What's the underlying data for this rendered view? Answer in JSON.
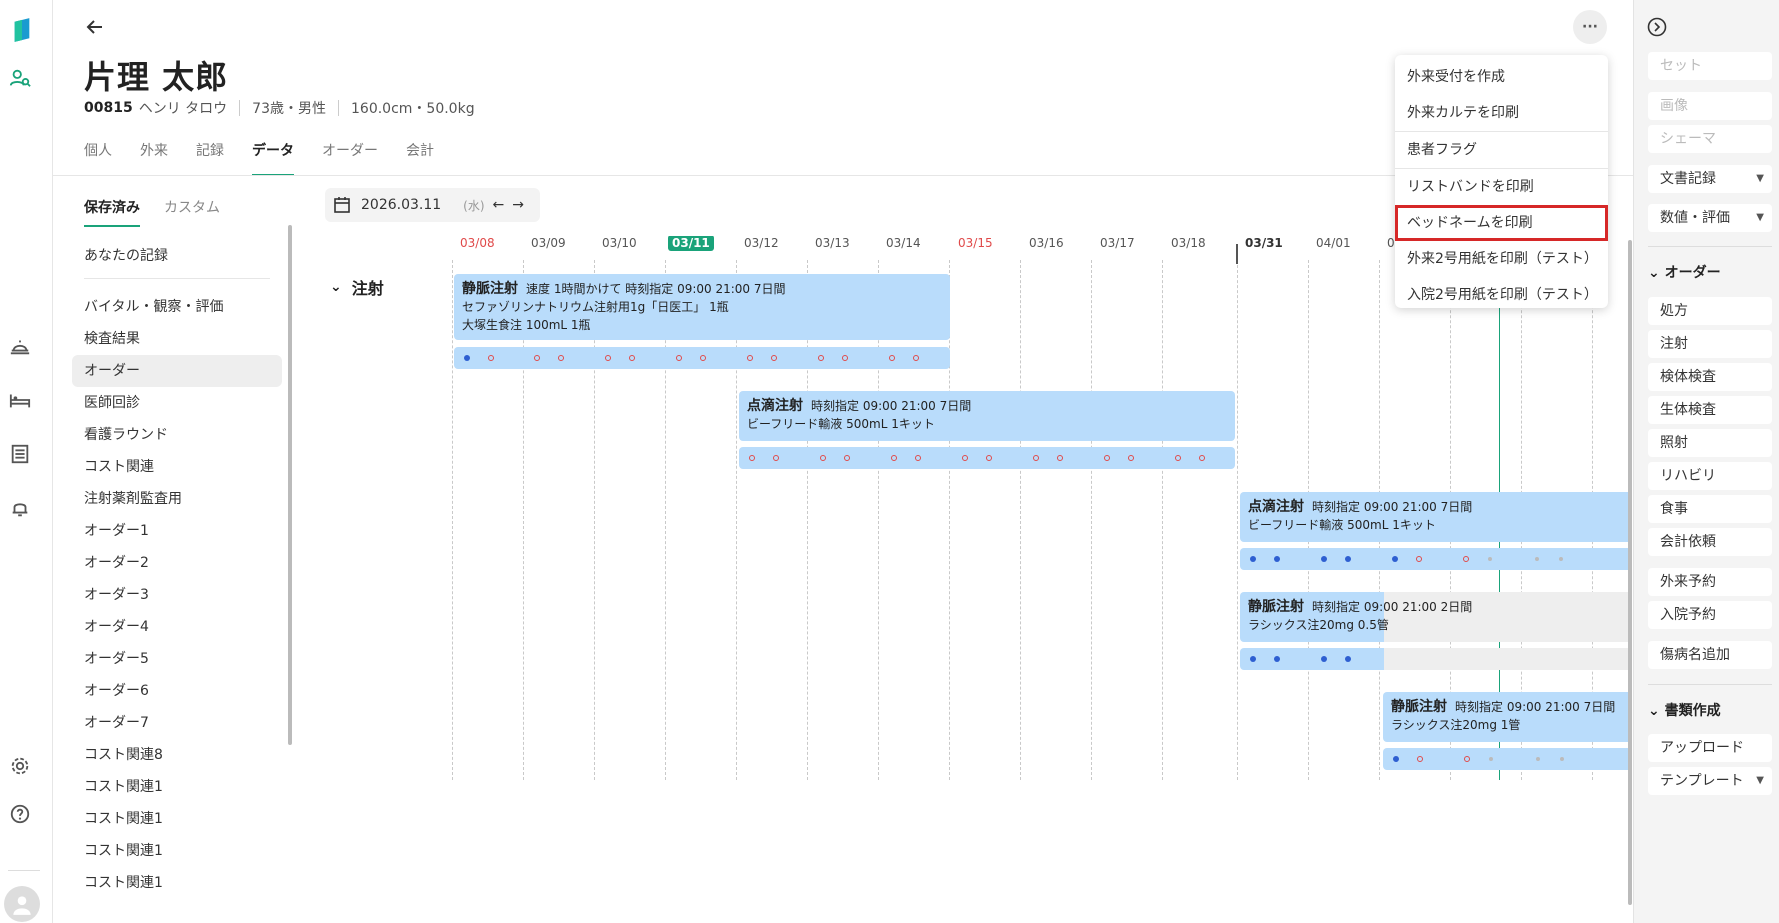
{
  "rail": {
    "icons": [
      "logo-icon",
      "patient-search-icon",
      "reception-icon",
      "bed-icon",
      "list-icon",
      "bell-icon",
      "settings-icon",
      "help-icon",
      "avatar"
    ]
  },
  "header": {
    "name": "片理 太郎",
    "patient_id": "00815",
    "kana": "ヘンリ タロウ",
    "age_sex": "73歳・男性",
    "height_weight": "160.0cm・50.0kg",
    "more_label": "···"
  },
  "tabs": [
    "個人",
    "外来",
    "記録",
    "データ",
    "オーダー",
    "会計"
  ],
  "active_tab": "データ",
  "subtabs": [
    "保存済み",
    "カスタム"
  ],
  "list": {
    "top": "あなたの記録",
    "items": [
      "バイタル・観察・評価",
      "検査結果",
      "オーダー",
      "医師回診",
      "看護ラウンド",
      "コスト関連",
      "注射薬剤監査用",
      "オーダー1",
      "オーダー2",
      "オーダー3",
      "オーダー4",
      "オーダー5",
      "オーダー6",
      "オーダー7",
      "コスト関連8",
      "コスト関連1",
      "コスト関連1",
      "コスト関連1",
      "コスト関連1"
    ]
  },
  "datepicker": {
    "date": "2026.03.11",
    "dow": "(水)",
    "prev": "←",
    "next": "→"
  },
  "timeline": {
    "dates": [
      "03/08",
      "03/09",
      "03/10",
      "03/11",
      "03/12",
      "03/13",
      "03/14",
      "03/15",
      "03/16",
      "03/17",
      "03/18",
      "03/31",
      "04/01",
      "0"
    ],
    "group": "注射",
    "orders": [
      {
        "title": "静脈注射",
        "detail": "速度 1時間かけて 時刻指定 09:00 21:00 7日間",
        "lines": [
          "セファゾリンナトリウム注射用1g「日医工」 1瓶",
          "大塚生食注 100mL 1瓶"
        ]
      },
      {
        "title": "点滴注射",
        "detail": "時刻指定 09:00 21:00 7日間",
        "lines": [
          "ビーフリード輸液 500mL 1キット"
        ]
      },
      {
        "title": "点滴注射",
        "detail": "時刻指定 09:00 21:00 7日間",
        "lines": [
          "ビーフリード輸液 500mL 1キット"
        ]
      },
      {
        "title": "静脈注射",
        "detail": "時刻指定 09:00 21:00 2日間",
        "lines": [
          "ラシックス注20mg 0.5管"
        ]
      },
      {
        "title": "静脈注射",
        "detail": "時刻指定 09:00 21:00 7日間",
        "lines": [
          "ラシックス注20mg 1管"
        ]
      }
    ]
  },
  "menu": {
    "items": [
      "外来受付を作成",
      "外来カルテを印刷",
      "患者フラグ",
      "リストバンドを印刷",
      "ベッドネームを印刷",
      "外来2号用紙を印刷（テスト）",
      "入院2号用紙を印刷（テスト）"
    ],
    "highlighted": "ベッドネームを印刷"
  },
  "right_panel": {
    "set": "セット",
    "image": "画像",
    "schema": "シェーマ",
    "doc_record": "文書記録",
    "numeric_eval": "数値・評価",
    "order_section": "オーダー",
    "order_items": [
      "処方",
      "注射",
      "検体検査",
      "生体検査",
      "照射",
      "リハビリ",
      "食事",
      "会計依頼"
    ],
    "outpatient_reserve": "外来予約",
    "inpatient_reserve": "入院予約",
    "add_disease": "傷病名追加",
    "docs_section": "書類作成",
    "upload": "アップロード",
    "template": "テンプレート"
  },
  "colors": {
    "accent": "#1aa37a",
    "order_block": "#b9dcfb",
    "highlight_border": "#d62828",
    "holiday": "#e04a4a"
  }
}
